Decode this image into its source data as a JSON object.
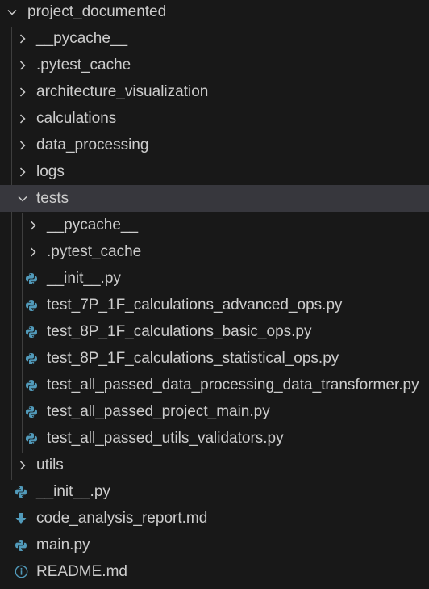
{
  "explorer": {
    "root": {
      "label": "project_documented",
      "icon": "chevron-down-icon"
    },
    "items": [
      {
        "label": "__pycache__",
        "icon": "chevron-right-icon",
        "kind": "folder-collapsed"
      },
      {
        "label": ".pytest_cache",
        "icon": "chevron-right-icon",
        "kind": "folder-collapsed"
      },
      {
        "label": "architecture_visualization",
        "icon": "chevron-right-icon",
        "kind": "folder-collapsed"
      },
      {
        "label": "calculations",
        "icon": "chevron-right-icon",
        "kind": "folder-collapsed"
      },
      {
        "label": "data_processing",
        "icon": "chevron-right-icon",
        "kind": "folder-collapsed"
      },
      {
        "label": "logs",
        "icon": "chevron-right-icon",
        "kind": "folder-collapsed"
      },
      {
        "label": "tests",
        "icon": "chevron-down-icon",
        "kind": "folder-expanded",
        "selected": true
      },
      {
        "label": "__pycache__",
        "icon": "chevron-right-icon",
        "kind": "folder-collapsed"
      },
      {
        "label": ".pytest_cache",
        "icon": "chevron-right-icon",
        "kind": "folder-collapsed"
      },
      {
        "label": "__init__.py",
        "icon": "python-file-icon",
        "kind": "file"
      },
      {
        "label": "test_7P_1F_calculations_advanced_ops.py",
        "icon": "python-file-icon",
        "kind": "file"
      },
      {
        "label": "test_8P_1F_calculations_basic_ops.py",
        "icon": "python-file-icon",
        "kind": "file"
      },
      {
        "label": "test_8P_1F_calculations_statistical_ops.py",
        "icon": "python-file-icon",
        "kind": "file"
      },
      {
        "label": "test_all_passed_data_processing_data_transformer.py",
        "icon": "python-file-icon",
        "kind": "file"
      },
      {
        "label": "test_all_passed_project_main.py",
        "icon": "python-file-icon",
        "kind": "file"
      },
      {
        "label": "test_all_passed_utils_validators.py",
        "icon": "python-file-icon",
        "kind": "file"
      },
      {
        "label": "utils",
        "icon": "chevron-right-icon",
        "kind": "folder-collapsed"
      },
      {
        "label": "__init__.py",
        "icon": "python-file-icon",
        "kind": "file"
      },
      {
        "label": "code_analysis_report.md",
        "icon": "markdown-download-icon",
        "kind": "file"
      },
      {
        "label": "main.py",
        "icon": "python-file-icon",
        "kind": "file"
      },
      {
        "label": "README.md",
        "icon": "info-icon",
        "kind": "file"
      }
    ],
    "colors": {
      "background": "#181818",
      "selected_row": "#37373d",
      "text": "#cccccc",
      "python_blue": "#519aba",
      "python_yellow": "#cbcb41",
      "markdown_blue": "#519aba",
      "info_blue": "#519aba"
    }
  }
}
